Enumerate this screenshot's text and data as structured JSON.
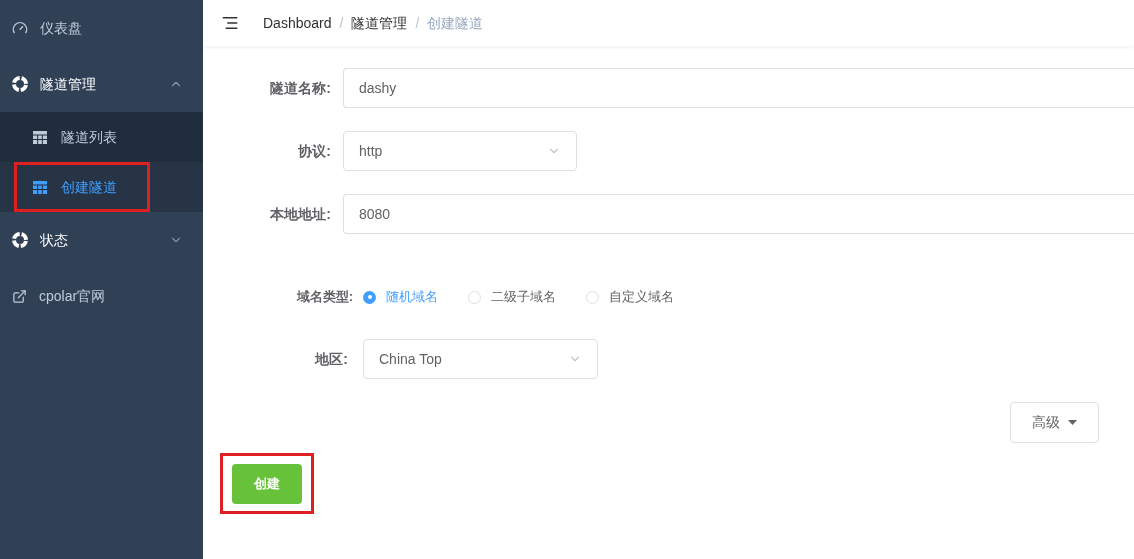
{
  "sidebar": {
    "items": [
      {
        "kind": "link",
        "label": "仪表盘"
      },
      {
        "kind": "group",
        "label": "隧道管理",
        "expanded": true,
        "children": [
          {
            "label": "隧道列表",
            "selected": false,
            "highlighted": false
          },
          {
            "label": "创建隧道",
            "selected": true,
            "highlighted": true
          }
        ]
      },
      {
        "kind": "group",
        "label": "状态",
        "expanded": false
      },
      {
        "kind": "link",
        "label": "cpolar官网"
      }
    ]
  },
  "breadcrumb": [
    {
      "label": "Dashboard",
      "current": false
    },
    {
      "label": "隧道管理",
      "current": false
    },
    {
      "label": "创建隧道",
      "current": true
    }
  ],
  "breadcrumb_separator": "/",
  "form": {
    "name": {
      "label": "隧道名称:",
      "value": "dashy"
    },
    "protocol": {
      "label": "协议:",
      "value": "http"
    },
    "local_address": {
      "label": "本地地址:",
      "value": "8080"
    },
    "domain_type": {
      "label": "域名类型:",
      "options": [
        {
          "label": "随机域名",
          "selected": true
        },
        {
          "label": "二级子域名",
          "selected": false
        },
        {
          "label": "自定义域名",
          "selected": false
        }
      ]
    },
    "region": {
      "label": "地区:",
      "value": "China Top"
    },
    "advanced_button": "高级",
    "create_button": {
      "label": "创建",
      "highlighted": true
    }
  }
}
